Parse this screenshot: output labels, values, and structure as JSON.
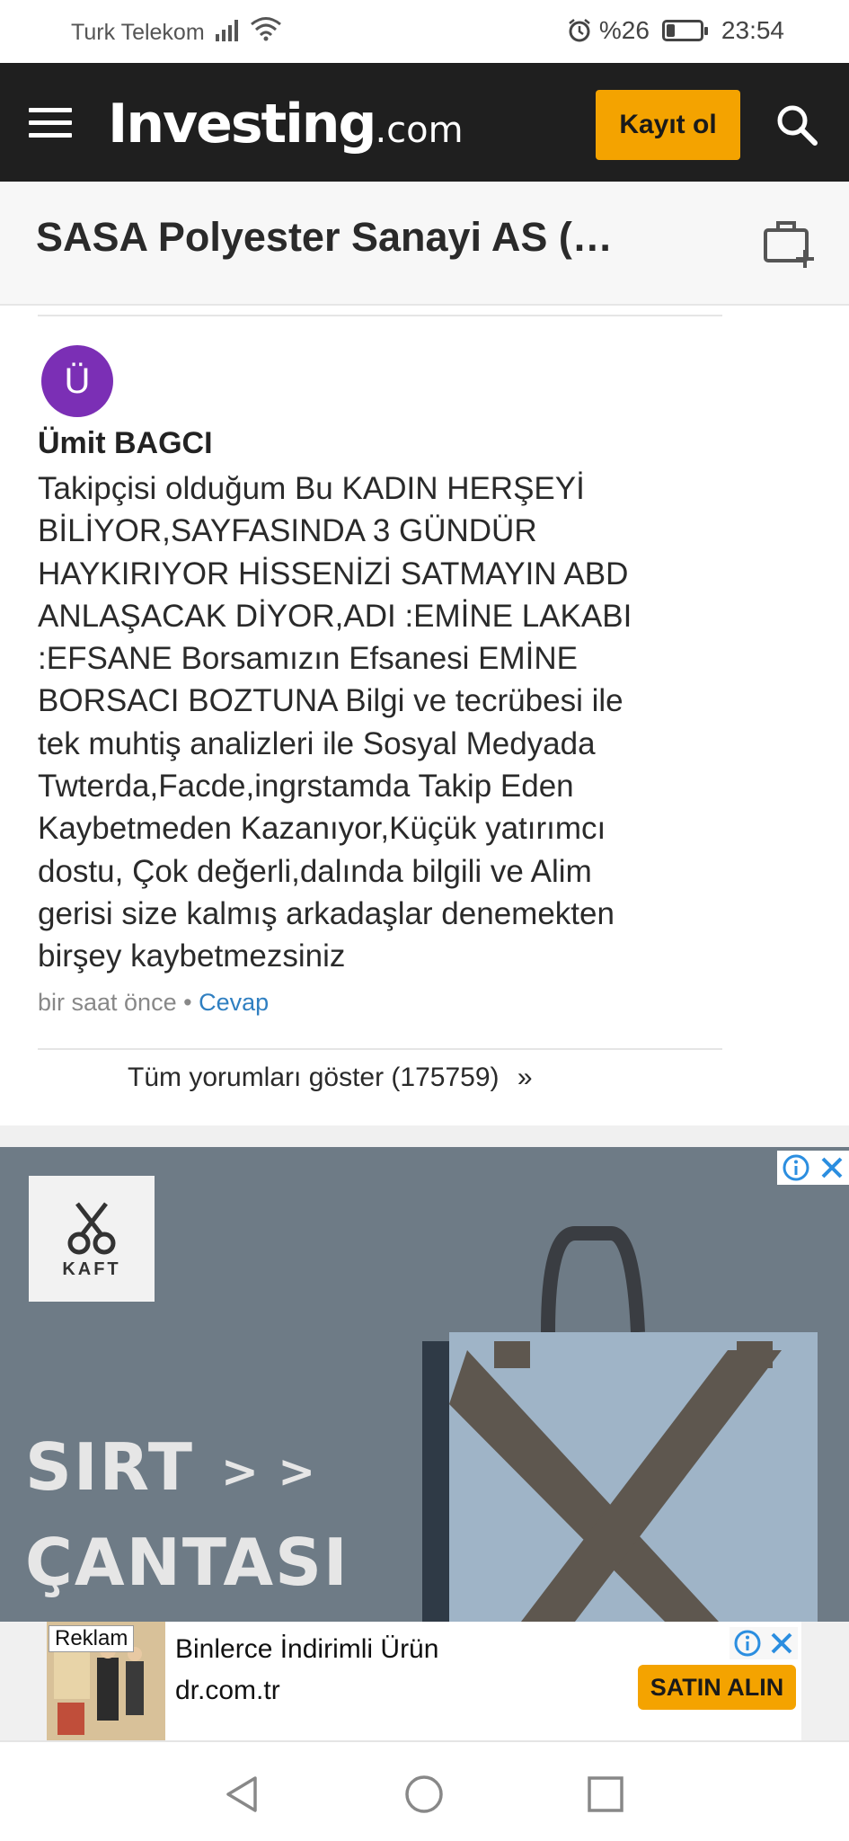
{
  "status_bar": {
    "carrier": "Turk Telekom",
    "battery_percent": "%26",
    "battery_level": 0.26,
    "time": "23:54"
  },
  "nav": {
    "logo_main": "Investing",
    "logo_suffix": ".com",
    "register_label": "Kayıt ol"
  },
  "title_bar": {
    "title": "SASA Polyester Sanayi AS (SASA)"
  },
  "comment": {
    "avatar_letter": "Ü",
    "author": "Ümit BAGCI",
    "body": "Takipçisi olduğum Bu  KADIN HERŞEYİ\nBİLİYOR,SAYFASINDA 3 GÜNDÜR\nHAYKIRIYOR HİSSENİZİ SATMAYIN ABD\nANLAŞACAK DİYOR,ADI :EMİNE LAKABI\n:EFSANE  Borsamızın  Efsanesi  EMİNE\nBORSACI BOZTUNA  Bilgi ve tecrübesi ile\ntek muhtiş analizleri ile Sosyal Medyada\nTwterda,Facde,ingrstamda   Takip Eden\nKaybetmeden Kazanıyor,Küçük yatırımcı\ndostu, Çok değerli,dalında bilgili ve Alim\ngerisi size kalmış arkadaşlar denemekten\nbirşey kaybetmezsiniz",
    "time_ago": "bir saat önce",
    "separator": "•",
    "reply_label": "Cevap"
  },
  "show_all": {
    "label": "Tüm yorumları göster (175759)",
    "arrow": "»"
  },
  "ad": {
    "brand": "KAFT",
    "line1": "SIRT",
    "line2": "ÇANTASI",
    "arrows": "> >"
  },
  "banner": {
    "badge": "Reklam",
    "title": "Binlerce İndirimli Ürün",
    "url": "dr.com.tr",
    "cta": "SATIN ALIN"
  }
}
